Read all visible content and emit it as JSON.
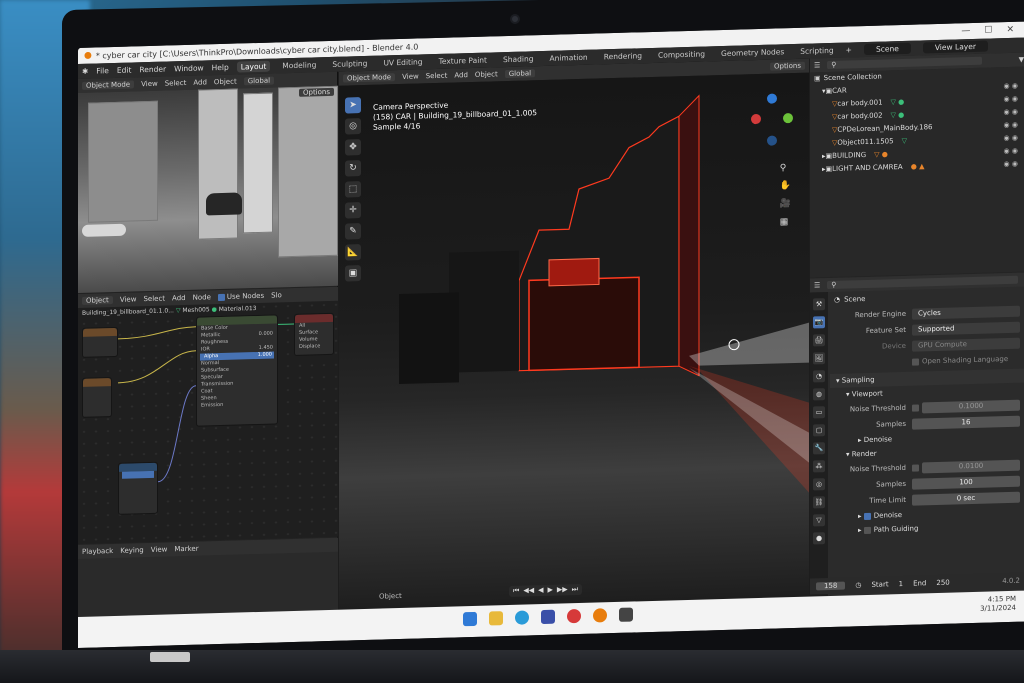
{
  "window": {
    "title": "* cyber car city [C:\\Users\\ThinkPro\\Downloads\\cyber car city.blend] - Blender 4.0",
    "controls": [
      "—",
      "☐",
      "✕"
    ]
  },
  "menu": {
    "items": [
      "File",
      "Edit",
      "Render",
      "Window",
      "Help"
    ],
    "workspaces": [
      "Layout",
      "Modeling",
      "Sculpting",
      "UV Editing",
      "Texture Paint",
      "Shading",
      "Animation",
      "Rendering",
      "Compositing",
      "Geometry Nodes",
      "Scripting"
    ],
    "active_workspace": "Layout",
    "add_tab": "+",
    "scene": "Scene",
    "view_layer": "View Layer"
  },
  "left_header": {
    "mode": "Object Mode",
    "items": [
      "View",
      "Select",
      "Add",
      "Object"
    ],
    "orientation": "Global",
    "options": "Options"
  },
  "node_header": {
    "type": "Object",
    "items": [
      "View",
      "Select",
      "Add",
      "Node"
    ],
    "use_nodes": "Use Nodes",
    "slot": "Slo",
    "breadcrumb_object": "Building_19_billboard_01.1.0...",
    "breadcrumb_mesh": "Mesh005",
    "breadcrumb_material": "Material.013"
  },
  "nodes": {
    "bsdf_rows": [
      "Base Color",
      "Metallic",
      "Roughness",
      "IOR",
      "Alpha",
      "Normal",
      "Subsurface",
      "Specular",
      "Transmission",
      "Coat",
      "Sheen",
      "Emission"
    ],
    "bsdf_values": {
      "metallic": "0.000",
      "ior": "1.450",
      "alpha": "1.000"
    },
    "output_rows": [
      "All",
      "Surface",
      "Volume",
      "Displace"
    ]
  },
  "timeline": {
    "items": [
      "Playback",
      "Keying",
      "View",
      "Marker"
    ]
  },
  "main_header": {
    "mode": "Object Mode",
    "items": [
      "View",
      "Select",
      "Add",
      "Object"
    ],
    "orientation": "Global",
    "options": "Options"
  },
  "viewport_info": {
    "line1": "Camera Perspective",
    "line2": "(158) CAR | Building_19_billboard_01_1.005",
    "line3": "Sample 4/16"
  },
  "viewport_footer": {
    "object_label": "Object"
  },
  "outliner": {
    "root": "Scene Collection",
    "rows": [
      {
        "name": "CAR",
        "indent": 1
      },
      {
        "name": "car body.001",
        "indent": 2
      },
      {
        "name": "car body.002",
        "indent": 2
      },
      {
        "name": "CPDeLorean_MainBody.186",
        "indent": 2
      },
      {
        "name": "Object011.1505",
        "indent": 2
      },
      {
        "name": "BUILDING",
        "indent": 1
      },
      {
        "name": "LIGHT AND CAMREA",
        "indent": 1
      }
    ]
  },
  "properties": {
    "context": "Scene",
    "render_engine_label": "Render Engine",
    "render_engine": "Cycles",
    "feature_set_label": "Feature Set",
    "feature_set": "Supported",
    "device_label": "Device",
    "device": "GPU Compute",
    "osl_label": "Open Shading Language",
    "sampling": "Sampling",
    "viewport": "Viewport",
    "noise_threshold_label": "Noise Threshold",
    "viewport_noise_threshold": "0.1000",
    "samples_label": "Samples",
    "viewport_samples": "16",
    "denoise_label": "Denoise",
    "render": "Render",
    "render_noise_threshold": "0.0100",
    "render_samples": "100",
    "time_limit_label": "Time Limit",
    "time_limit": "0 sec",
    "path_guiding_label": "Path Guiding"
  },
  "frame_bar": {
    "current": "158",
    "start_label": "Start",
    "start": "1",
    "end_label": "End",
    "end": "250",
    "version": "4.0.2"
  },
  "taskbar": {
    "time": "4:15 PM",
    "date": "3/11/2024"
  },
  "colors": {
    "blender_accent": "#4772b3",
    "render_highlight": "#ff3a1f",
    "outliner_green": "#3cbf7a",
    "outliner_orange": "#e8852b"
  }
}
